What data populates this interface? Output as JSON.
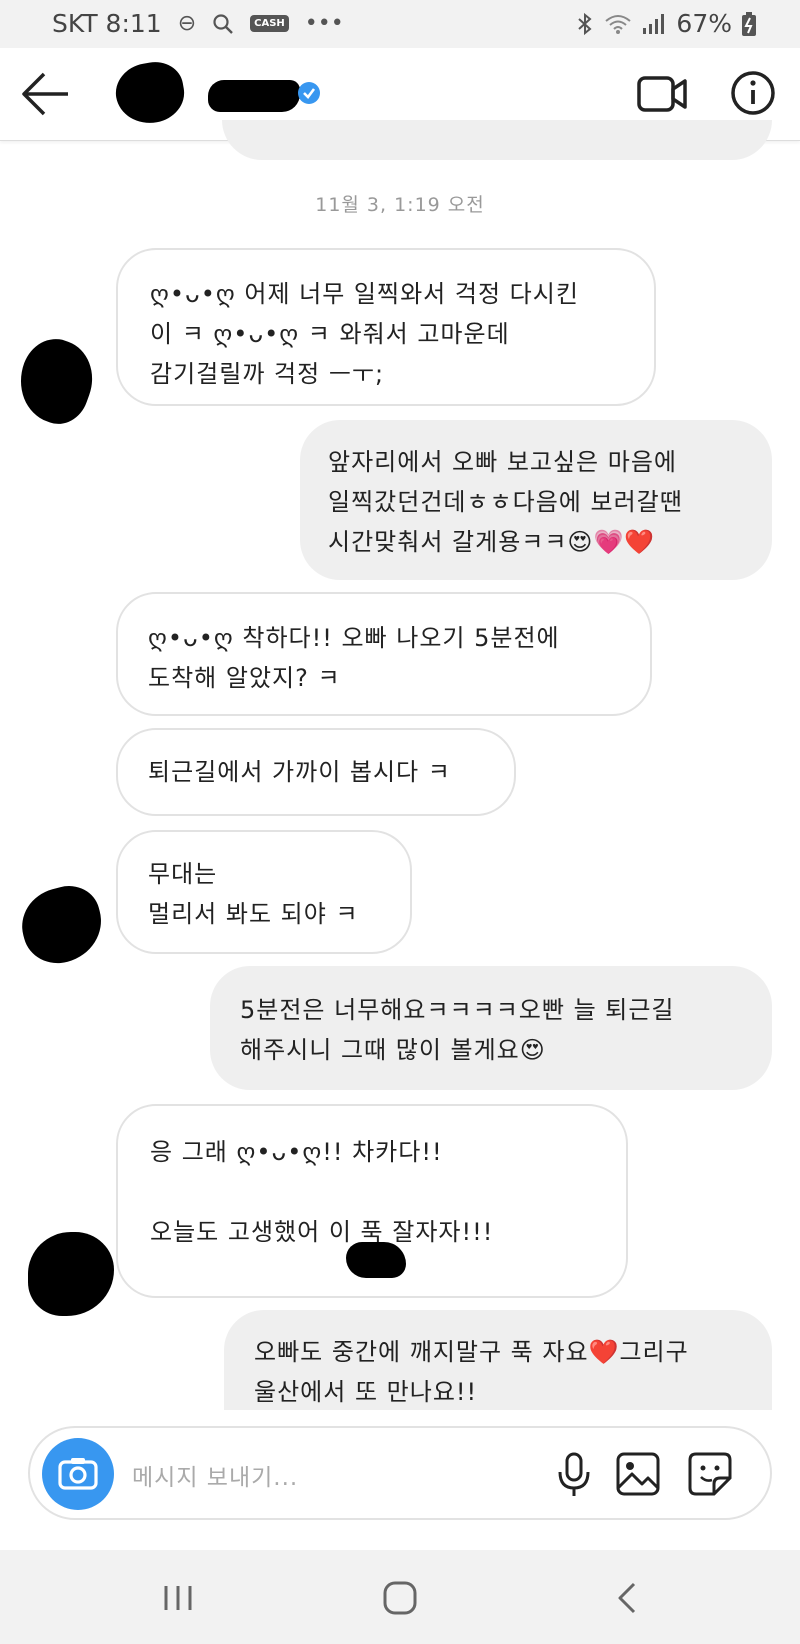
{
  "status_bar": {
    "carrier": "SKT",
    "time": "8:11",
    "battery": "67%",
    "icons": [
      "minus-circle-icon",
      "search-icon",
      "cash-icon",
      "more-dots-icon",
      "bluetooth-icon",
      "wifi-icon",
      "signal-icon",
      "battery-charging-icon"
    ],
    "cash_label": "CASH"
  },
  "header": {
    "icons": [
      "back-arrow-icon",
      "verified-badge-icon",
      "video-call-icon",
      "info-icon"
    ],
    "accent": "#3897f0"
  },
  "conversation": {
    "timestamp": "11월 3, 1:19 오전",
    "messages": [
      {
        "from": "them",
        "text": "ღ•ᴗ•ღ 어제 너무 일찍와서 걱정 다시킨\n이 ㅋ ღ•ᴗ•ღ ㅋ 와줘서 고마운데\n감기걸릴까 걱정 ㅡㅜ;"
      },
      {
        "from": "me",
        "text": "앞자리에서 오빠 보고싶은 마음에\n일찍갔던건데ㅎㅎ다음에 보러갈땐\n시간맞춰서 갈게용ㅋㅋ😍💗❤️"
      },
      {
        "from": "them",
        "text": "ღ•ᴗ•ღ 착하다!! 오빠 나오기 5분전에\n도착해 알았지? ㅋ"
      },
      {
        "from": "them",
        "text": "퇴근길에서 가까이 봅시다 ㅋ"
      },
      {
        "from": "them",
        "text": "무대는\n멀리서 봐도 되야 ㅋ"
      },
      {
        "from": "me",
        "text": "5분전은 너무해요ㅋㅋㅋㅋ오빤 늘 퇴근길\n해주시니 그때 많이 볼게요😍"
      },
      {
        "from": "them",
        "text": "응 그래 ღ•ᴗ•ღ!! 차카다!!\n\n오늘도 고생했어    이 푹 잘자자!!!"
      },
      {
        "from": "me",
        "text": "오빠도 중간에 깨지말구 푹 자요❤️그리구\n울산에서 또 만나요!!"
      }
    ]
  },
  "composer": {
    "placeholder": "메시지 보내기...",
    "icons": [
      "camera-icon",
      "microphone-icon",
      "gallery-icon",
      "sticker-icon"
    ],
    "camera_color": "#3897f0"
  },
  "nav_bar": {
    "icons": [
      "recent-apps-icon",
      "home-icon",
      "back-icon"
    ]
  }
}
